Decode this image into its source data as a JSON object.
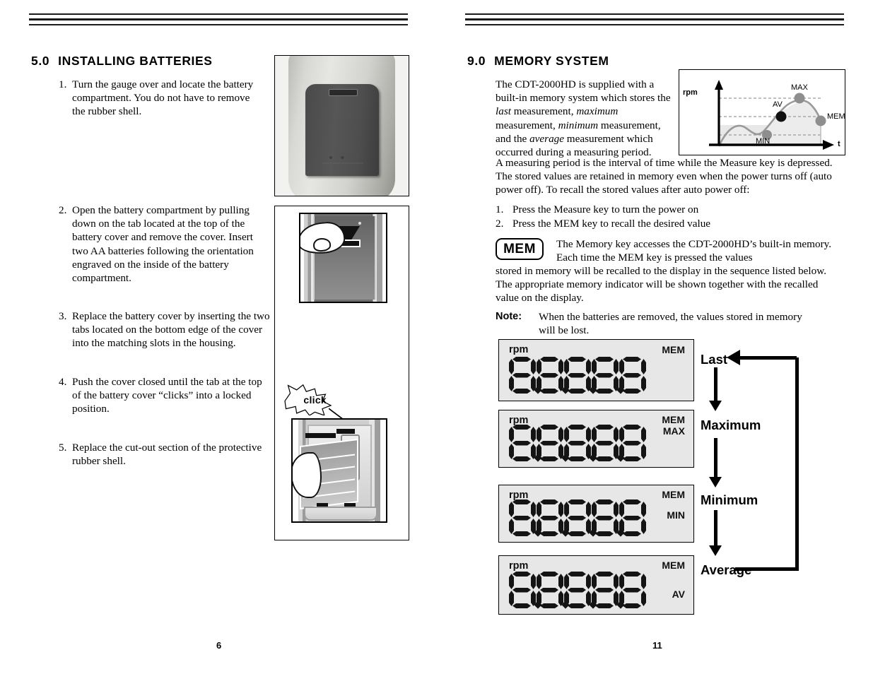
{
  "document": {
    "left_page": {
      "page_number": "6",
      "section_number": "5.0",
      "section_title": "INSTALLING BATTERIES",
      "steps": [
        {
          "num": "1.",
          "text": "Turn the gauge over and locate the battery compartment. You do not have to remove the rubber shell."
        },
        {
          "num": "2.",
          "text": "Open the battery compartment by pulling down on the tab located at the top of the battery cover and remove the cover. Insert two AA batteries following the orientation engraved on the inside of the battery compartment."
        },
        {
          "num": "3.",
          "text": "Replace the battery cover by inserting the two tabs located on the bottom edge of the cover into the matching slots in the housing."
        },
        {
          "num": "4.",
          "text": "Push the cover closed until the tab at the top of the battery cover “clicks” into a locked position."
        },
        {
          "num": "5.",
          "text": "Replace the cut-out section of the protective rubber shell."
        }
      ],
      "figures": {
        "photo_battery_cover": "photo-battery-compartment-cover",
        "illustration_pull_tab": "illustration-pull-down-tab",
        "illustration_click": "illustration-cover-clicks-closed",
        "click_label": "click",
        "battery_plus_label": "+"
      }
    },
    "right_page": {
      "page_number": "11",
      "section_number": "9.0",
      "section_title": "MEMORY SYSTEM",
      "intro_parts": [
        {
          "text": "The CDT-2000HD is supplied with a built-in memory system which stores the ",
          "style": "normal"
        },
        {
          "text": "last",
          "style": "italic"
        },
        {
          "text": " measurement, ",
          "style": "normal"
        },
        {
          "text": "maximum",
          "style": "italic"
        },
        {
          "text": " measurement, ",
          "style": "normal"
        },
        {
          "text": "minimum",
          "style": "italic"
        },
        {
          "text": " measurement, and the ",
          "style": "normal"
        },
        {
          "text": "average",
          "style": "italic"
        },
        {
          "text": " measurement which occurred during a measuring period.",
          "style": "normal"
        }
      ],
      "paragraph2": "A measuring period is the interval of time while the Measure key is depressed. The stored values are retained in memory even when the power turns off (auto power off). To recall the stored values after auto power off:",
      "recall_steps": [
        {
          "num": "1.",
          "text": "Press the Measure key to turn the power on"
        },
        {
          "num": "2.",
          "text": "Press the MEM key to recall the desired value"
        }
      ],
      "mem_key_label": "MEM",
      "mem_paragraph_indented": "The Memory key accesses the CDT-2000HD’s built-in memory. Each time the MEM key is pressed the values",
      "mem_paragraph_rest": "stored in memory will be recalled to the display in the sequence listed below. The appropriate memory indicator will be shown together with the recalled value on the display.",
      "note_label": "Note:",
      "note_text": "When the batteries are removed, the values stored in memory will be lost.",
      "displays": [
        {
          "rpm": "rpm",
          "indicators": [
            "MEM"
          ],
          "digits": "8.8.8.8.8",
          "flow_label": "Last"
        },
        {
          "rpm": "rpm",
          "indicators": [
            "MEM",
            "MAX"
          ],
          "digits": "8.8.8.8.8",
          "flow_label": "Maximum"
        },
        {
          "rpm": "rpm",
          "indicators": [
            "MEM",
            "MIN"
          ],
          "digits": "8.8.8.8.8",
          "flow_label": "Minimum"
        },
        {
          "rpm": "rpm",
          "indicators": [
            "MEM",
            "AV"
          ],
          "digits": "8.8.8.8.8",
          "flow_label": "Average"
        }
      ]
    }
  },
  "chart_data": {
    "type": "line",
    "title": "",
    "xlabel": "t",
    "ylabel": "rpm",
    "grid": true,
    "legend": "none",
    "annotations": [
      "MIN",
      "AV",
      "MAX",
      "MEM"
    ],
    "x": [
      0,
      8,
      20,
      32,
      44,
      56,
      68,
      80,
      92,
      100
    ],
    "y": [
      0,
      34,
      44,
      40,
      27,
      38,
      55,
      68,
      72,
      47
    ],
    "markers": [
      {
        "label": "MIN",
        "x": 44,
        "y": 27,
        "color": "#8e8e8e"
      },
      {
        "label": "AV",
        "x": 58,
        "y": 46,
        "color": "#111111"
      },
      {
        "label": "MAX",
        "x": 80,
        "y": 70,
        "color": "#8e8e8e"
      },
      {
        "label": "MEM",
        "x": 100,
        "y": 45,
        "color": "#8e8e8e"
      }
    ],
    "gridlines_y": [
      27,
      46,
      70
    ],
    "ylim": [
      0,
      90
    ],
    "xlim": [
      0,
      115
    ],
    "colors": {
      "curve": "#9a9a9a",
      "fill": "#e8e8e8",
      "axis": "#000000",
      "gridline": "#9a9a9a",
      "marker_gray": "#8e8e8e",
      "marker_black": "#111111"
    }
  },
  "colors": {
    "rule": "#1b1b1b",
    "lcd_background": "#e7e7e7",
    "lcd_segment": "#141414",
    "text": "#000000"
  }
}
